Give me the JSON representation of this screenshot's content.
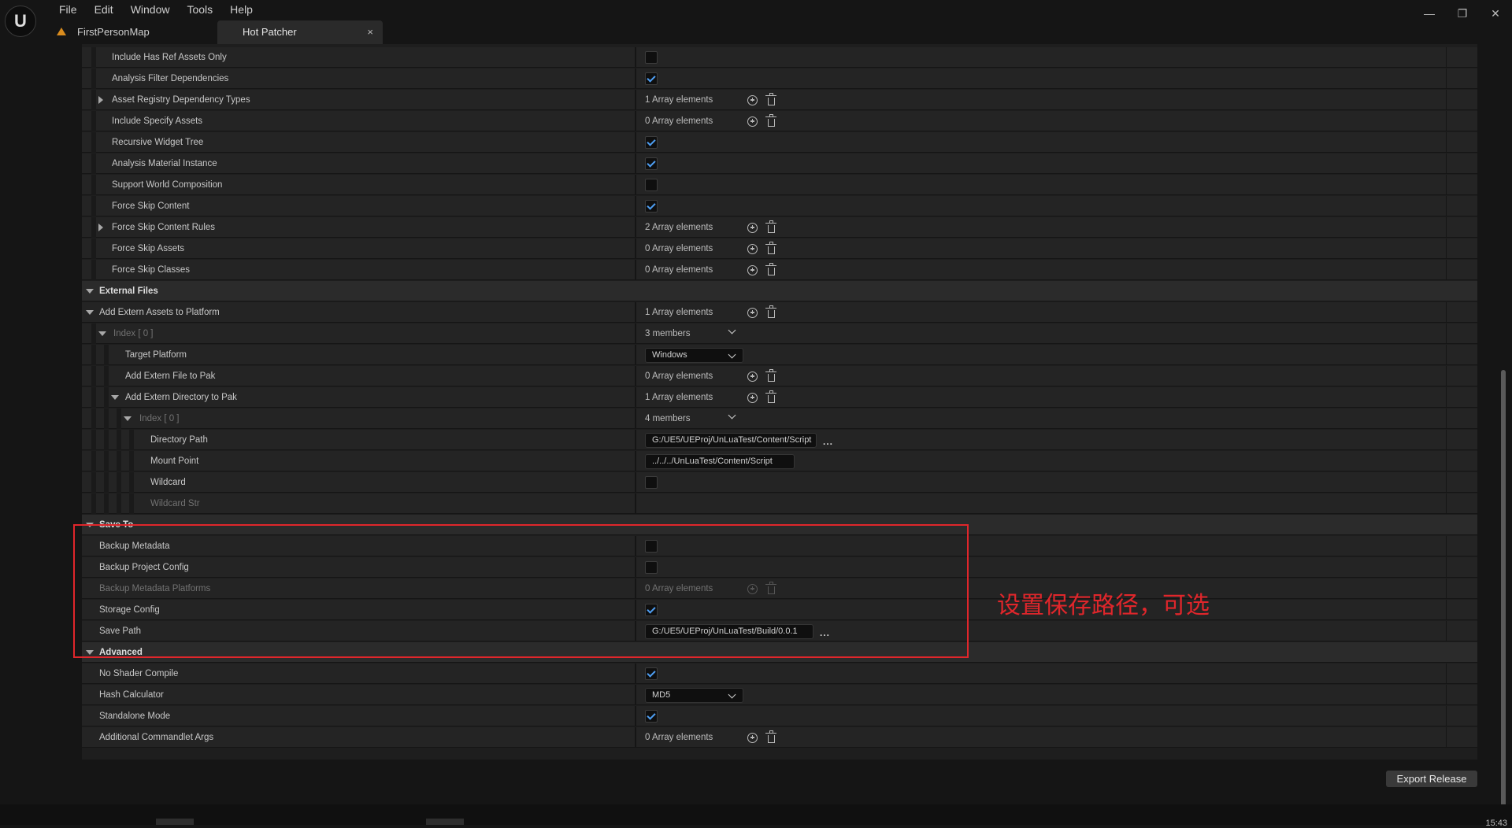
{
  "menu": [
    "File",
    "Edit",
    "Window",
    "Tools",
    "Help"
  ],
  "tabs": {
    "level": "FirstPersonMap",
    "tool": "Hot Patcher",
    "close": "×"
  },
  "window_controls": {
    "minimize": "—",
    "restore": "❐",
    "close": "✕"
  },
  "rows": [
    {
      "label": "Include Has Ref Assets Only",
      "type": "check",
      "checked": false
    },
    {
      "label": "Analysis Filter Dependencies",
      "type": "check",
      "checked": true
    },
    {
      "label": "Asset Registry Dependency Types",
      "type": "array",
      "value": "1 Array elements",
      "expander": "right"
    },
    {
      "label": "Include Specify Assets",
      "type": "array",
      "value": "0 Array elements"
    },
    {
      "label": "Recursive Widget Tree",
      "type": "check",
      "checked": true
    },
    {
      "label": "Analysis Material Instance",
      "type": "check",
      "checked": true
    },
    {
      "label": "Support World Composition",
      "type": "check",
      "checked": false
    },
    {
      "label": "Force Skip Content",
      "type": "check",
      "checked": true
    },
    {
      "label": "Force Skip Content Rules",
      "type": "array",
      "value": "2 Array elements",
      "expander": "right"
    },
    {
      "label": "Force Skip Assets",
      "type": "array",
      "value": "0 Array elements"
    },
    {
      "label": "Force Skip Classes",
      "type": "array",
      "value": "0 Array elements"
    },
    {
      "label": "External Files",
      "type": "category"
    },
    {
      "label": "Add Extern Assets to Platform",
      "type": "array",
      "value": "1 Array elements",
      "expander": "down"
    },
    {
      "label": "Index [ 0 ]",
      "type": "members",
      "value": "3 members",
      "expander": "down",
      "dimlabel": true
    },
    {
      "label": "Target Platform",
      "type": "combo",
      "value": "Windows"
    },
    {
      "label": "Add Extern File to Pak",
      "type": "array",
      "value": "0 Array elements"
    },
    {
      "label": "Add Extern Directory to Pak",
      "type": "array",
      "value": "1 Array elements",
      "expander": "down"
    },
    {
      "label": "Index [ 0 ]",
      "type": "members",
      "value": "4 members",
      "expander": "down",
      "dimlabel": true
    },
    {
      "label": "Directory Path",
      "type": "path",
      "value": "G:/UE5/UEProj/UnLuaTest/Content/Script",
      "dots": "..."
    },
    {
      "label": "Mount Point",
      "type": "path",
      "value": "../../../UnLuaTest/Content/Script"
    },
    {
      "label": "Wildcard",
      "type": "check",
      "checked": false
    },
    {
      "label": "Wildcard Str",
      "type": "empty",
      "dimlabel": true
    },
    {
      "label": "Save To",
      "type": "category"
    },
    {
      "label": "Backup Metadata",
      "type": "check",
      "checked": false
    },
    {
      "label": "Backup Project Config",
      "type": "check",
      "checked": false
    },
    {
      "label": "Backup Metadata Platforms",
      "type": "array",
      "value": "0 Array elements",
      "disabled": true
    },
    {
      "label": "Storage Config",
      "type": "check",
      "checked": true
    },
    {
      "label": "Save Path",
      "type": "path",
      "value": "G:/UE5/UEProj/UnLuaTest/Build/0.0.1",
      "dots": "..."
    },
    {
      "label": "Advanced",
      "type": "category"
    },
    {
      "label": "No Shader Compile",
      "type": "check",
      "checked": true
    },
    {
      "label": "Hash Calculator",
      "type": "combo",
      "value": "MD5"
    },
    {
      "label": "Standalone Mode",
      "type": "check",
      "checked": true
    },
    {
      "label": "Additional Commandlet Args",
      "type": "array",
      "value": "0 Array elements"
    }
  ],
  "annotation": "设置保存路径，可选",
  "export_button": "Export Release",
  "clock": "15:43",
  "colors": {
    "accent_check": "#4e9ef2",
    "annotation": "#e0262b",
    "level_icon": "#d98c1e"
  }
}
